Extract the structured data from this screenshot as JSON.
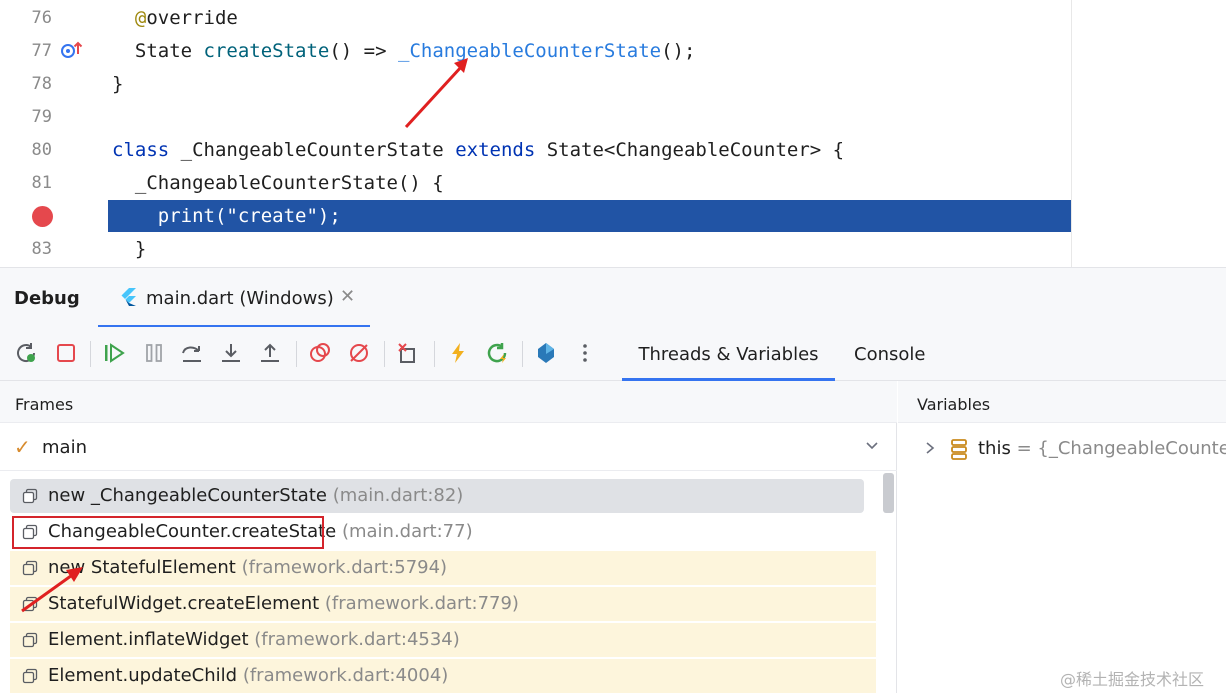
{
  "editor": {
    "lines": [
      {
        "num": "76",
        "parts": [
          {
            "t": "  ",
            "c": ""
          },
          {
            "t": "@",
            "c": "ann"
          },
          {
            "t": "override",
            "c": ""
          }
        ]
      },
      {
        "num": "77",
        "parts": [
          {
            "t": "  State ",
            "c": ""
          },
          {
            "t": "createState",
            "c": "fn"
          },
          {
            "t": "() => ",
            "c": ""
          },
          {
            "t": "_ChangeableCounterState",
            "c": "link"
          },
          {
            "t": "();",
            "c": ""
          }
        ]
      },
      {
        "num": "78",
        "parts": [
          {
            "t": "}",
            "c": ""
          }
        ]
      },
      {
        "num": "79",
        "parts": []
      },
      {
        "num": "80",
        "parts": [
          {
            "t": "class",
            "c": "kw"
          },
          {
            "t": " _ChangeableCounterState ",
            "c": ""
          },
          {
            "t": "extends",
            "c": "kw"
          },
          {
            "t": " State<ChangeableCounter> {",
            "c": ""
          }
        ]
      },
      {
        "num": "81",
        "parts": [
          {
            "t": "  _ChangeableCounterState() {",
            "c": ""
          }
        ]
      },
      {
        "num": "",
        "parts": [
          {
            "t": "    print(\"create\");",
            "c": "hl-code"
          }
        ]
      },
      {
        "num": "83",
        "parts": [
          {
            "t": "  }",
            "c": ""
          }
        ]
      }
    ]
  },
  "debug": {
    "title": "Debug",
    "session_tab": "main.dart (Windows)"
  },
  "toolbar": {
    "tabs": [
      "Threads & Variables",
      "Console"
    ]
  },
  "frames": {
    "header": "Frames",
    "thread": "main",
    "items": [
      {
        "name": "new _ChangeableCounterState",
        "loc": "(main.dart:82)"
      },
      {
        "name": "ChangeableCounter.createState",
        "loc": "(main.dart:77)"
      },
      {
        "name": "new StatefulElement",
        "loc": "(framework.dart:5794)"
      },
      {
        "name": "StatefulWidget.createElement",
        "loc": "(framework.dart:779)"
      },
      {
        "name": "Element.inflateWidget",
        "loc": "(framework.dart:4534)"
      },
      {
        "name": "Element.updateChild",
        "loc": "(framework.dart:4004)"
      }
    ]
  },
  "variables": {
    "header": "Variables",
    "row_name": "this",
    "row_value": " = {_ChangeableCounterS"
  },
  "watermark": "@稀土掘金技术社区",
  "colors": {
    "highlight": "#2154a5",
    "accent": "#3574f0",
    "breakpoint": "#e5484d",
    "annotation_red": "#d4242b"
  }
}
